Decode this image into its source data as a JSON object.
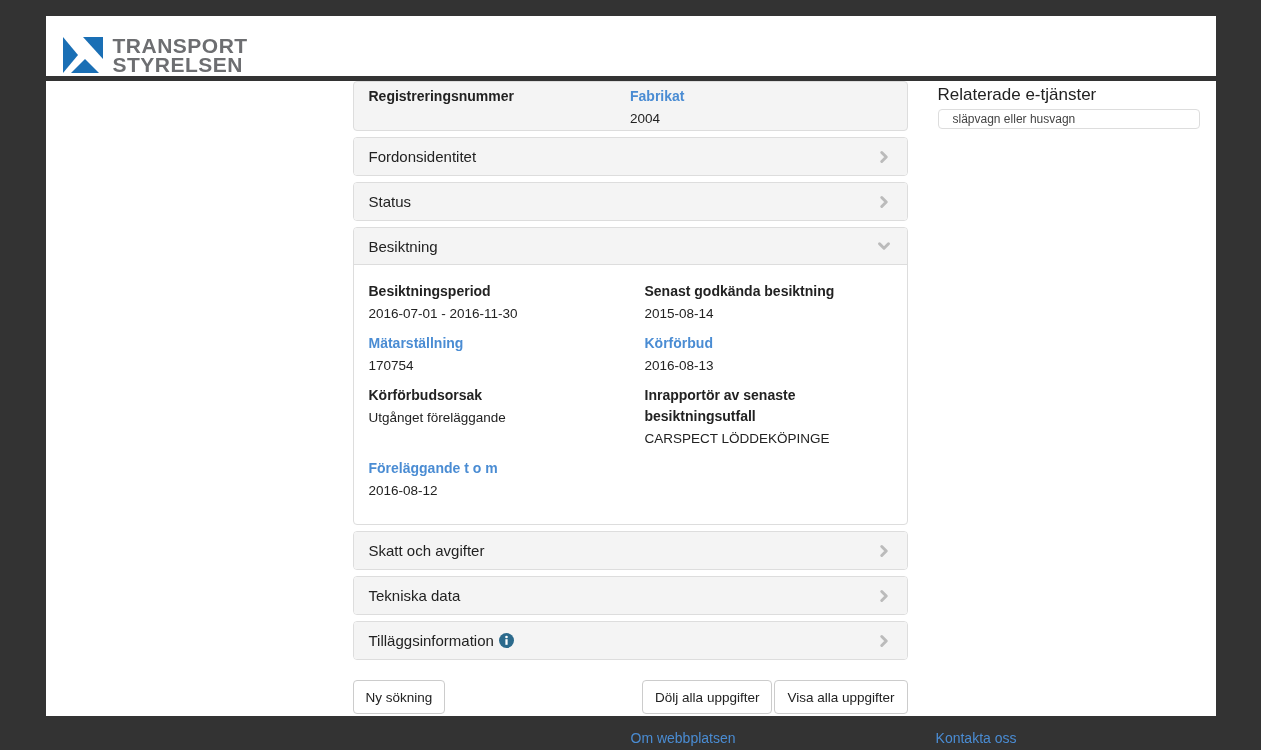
{
  "header": {
    "logo_lines": [
      "TRANSPORT",
      "STYRELSEN"
    ]
  },
  "summary": {
    "fields": [
      {
        "label": "Registreringsnummer",
        "kind": "plain"
      },
      {
        "label": "Fabrikat",
        "kind": "link",
        "value": "2004"
      }
    ]
  },
  "sections": [
    {
      "title": "Fordonsidentitet",
      "expanded": false
    },
    {
      "title": "Status",
      "expanded": false
    },
    {
      "title": "Besiktning",
      "expanded": true,
      "fields": [
        {
          "label": "Besiktningsperiod",
          "kind": "plain",
          "value": "2016-07-01 - 2016-11-30"
        },
        {
          "label": "Senast godkända besiktning",
          "kind": "plain",
          "value": "2015-08-14"
        },
        {
          "label": "Mätarställning",
          "kind": "link",
          "value": "170754"
        },
        {
          "label": "Körförbud",
          "kind": "link",
          "value": "2016-08-13"
        },
        {
          "label": "Körförbudsorsak",
          "kind": "plain",
          "value": "Utgånget föreläggande"
        },
        {
          "label": "Inrapportör av senaste besiktningsutfall",
          "kind": "plain",
          "value": "CARSPECT LÖDDEKÖPINGE"
        },
        {
          "label": "Föreläggande t o m",
          "kind": "link",
          "value": "2016-08-12"
        }
      ]
    },
    {
      "title": "Skatt och avgifter",
      "expanded": false
    },
    {
      "title": "Tekniska data",
      "expanded": false
    },
    {
      "title": "Tilläggsinformation",
      "expanded": false,
      "info": true
    }
  ],
  "buttons": {
    "left": [
      "Ny sökning"
    ],
    "right": [
      "Dölj alla uppgifter",
      "Visa alla uppgifter"
    ]
  },
  "related": {
    "title": "Relaterade e-tjänster",
    "items": [
      "släpvagn eller husvagn"
    ]
  },
  "footer": {
    "links": [
      "Om webbplatsen",
      "Kontakta oss"
    ]
  }
}
